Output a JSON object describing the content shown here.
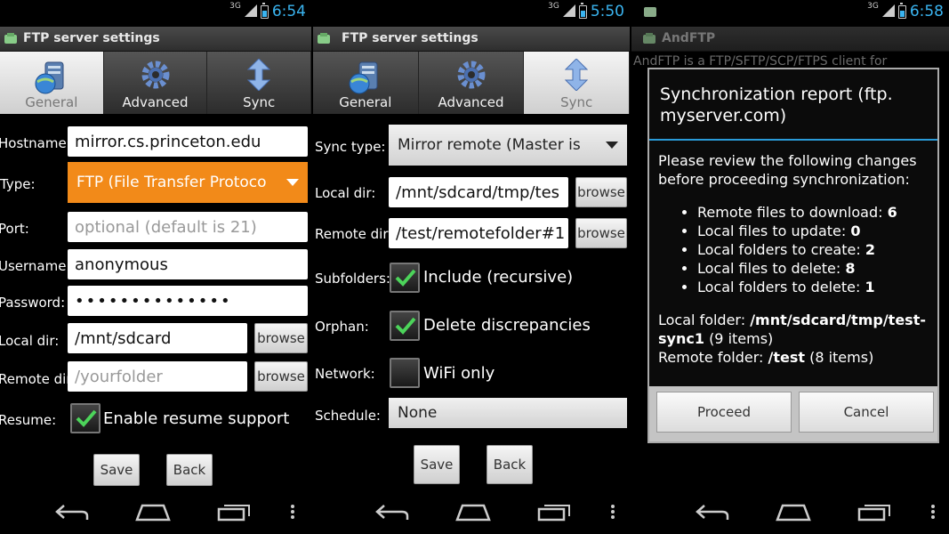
{
  "status": [
    {
      "network": "3G",
      "time": "6:54"
    },
    {
      "network": "3G",
      "time": "5:50"
    },
    {
      "network": "3G",
      "time": "6:58"
    }
  ],
  "screen1": {
    "title": "FTP server settings",
    "tabs": [
      "General",
      "Advanced",
      "Sync"
    ],
    "hostname_label": "Hostname:",
    "hostname_value": "mirror.cs.princeton.edu",
    "type_label": "Type:",
    "type_value": "FTP (File Transfer Protoco",
    "port_label": "Port:",
    "port_placeholder": "optional (default is 21)",
    "username_label": "Username:",
    "username_value": "anonymous",
    "password_label": "Password:",
    "password_value": "••••••••••••••",
    "localdir_label": "Local dir:",
    "localdir_value": "/mnt/sdcard",
    "remotedir_label": "Remote dir:",
    "remotedir_placeholder": "/yourfolder",
    "browse_label": "browse",
    "resume_label": "Resume:",
    "resume_checkbox_label": "Enable resume support",
    "save_label": "Save",
    "back_label": "Back"
  },
  "screen2": {
    "title": "FTP server settings",
    "tabs": [
      "General",
      "Advanced",
      "Sync"
    ],
    "synctype_label": "Sync type:",
    "synctype_value": "Mirror remote (Master is",
    "localdir_label": "Local dir:",
    "localdir_value": "/mnt/sdcard/tmp/tes",
    "remotedir_label": "Remote dir:",
    "remotedir_value": "/test/remotefolder#1",
    "browse_label": "browse",
    "subfolders_label": "Subfolders:",
    "subfolders_checkbox_label": "Include (recursive)",
    "orphan_label": "Orphan:",
    "orphan_checkbox_label": "Delete discrepancies",
    "network_label": "Network:",
    "network_checkbox_label": "WiFi only",
    "schedule_label": "Schedule:",
    "schedule_value": "None",
    "save_label": "Save",
    "back_label": "Back"
  },
  "screen3": {
    "title": "AndFTP",
    "background_text": "AndFTP is a FTP/SFTP/SCP/FTPS client for",
    "dialog_title": "Synchronization report (ftp. myserver.com)",
    "intro": "Please review the following changes before proceeding synchronization:",
    "changes": [
      {
        "label": "Remote files to download:",
        "value": "6"
      },
      {
        "label": "Local files to update:",
        "value": "0"
      },
      {
        "label": "Local folders to create:",
        "value": "2"
      },
      {
        "label": "Local files to delete:",
        "value": "8"
      },
      {
        "label": "Local folders to delete:",
        "value": "1"
      }
    ],
    "local_folder_label": "Local folder:",
    "local_folder_value": "/mnt/sdcard/tmp/test-sync1",
    "local_folder_count": "(9 items)",
    "remote_folder_label": "Remote folder:",
    "remote_folder_value": "/test",
    "remote_folder_count": "(8 items)",
    "proceed_label": "Proceed",
    "cancel_label": "Cancel"
  },
  "colors": {
    "accent": "#3ab4f0",
    "orange": "#f28a19",
    "check": "#4cd45a"
  }
}
